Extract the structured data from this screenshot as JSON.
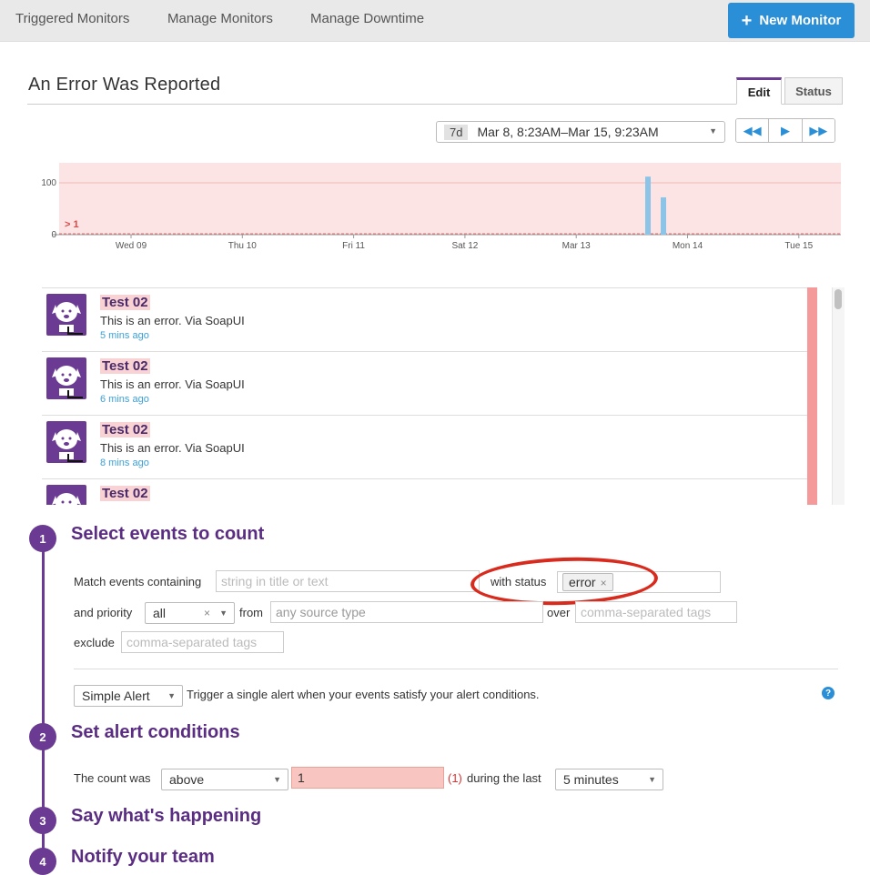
{
  "nav": {
    "tabs": [
      "Triggered Monitors",
      "Manage Monitors",
      "Manage Downtime"
    ],
    "new_monitor": "New Monitor"
  },
  "header": {
    "title": "An Error Was Reported",
    "tab_edit": "Edit",
    "tab_status": "Status"
  },
  "timeframe": {
    "span": "7d",
    "range": "Mar 8, 8:23AM–Mar 15, 9:23AM"
  },
  "chart_data": {
    "type": "bar",
    "x_ticks": [
      "Wed 09",
      "Thu 10",
      "Fri 11",
      "Sat 12",
      "Mar 13",
      "Mon 14",
      "Tue 15"
    ],
    "y_ticks": [
      0,
      100
    ],
    "ylim": [
      0,
      140
    ],
    "threshold_label": "> 1",
    "threshold": 1,
    "bars": [
      {
        "x": "Mar 13 19:30",
        "value": 112
      },
      {
        "x": "Mar 13 22:30",
        "value": 72
      }
    ],
    "colors": {
      "bar": "#8cc4e8",
      "alert_band": "#fde4e4",
      "threshold_text": "#e04848"
    }
  },
  "events": [
    {
      "title": "Test 02",
      "body": "This is an error. Via SoapUI",
      "time": "5 mins ago"
    },
    {
      "title": "Test 02",
      "body": "This is an error. Via SoapUI",
      "time": "6 mins ago"
    },
    {
      "title": "Test 02",
      "body": "This is an error. Via SoapUI",
      "time": "8 mins ago"
    },
    {
      "title": "Test 02",
      "body": "",
      "time": ""
    }
  ],
  "steps": {
    "s1": {
      "num": "1",
      "title": "Select events to count"
    },
    "s2": {
      "num": "2",
      "title": "Set alert conditions"
    },
    "s3": {
      "num": "3",
      "title": "Say what's happening"
    },
    "s4": {
      "num": "4",
      "title": "Notify your team"
    }
  },
  "form": {
    "match_label": "Match events containing",
    "match_placeholder": "string in title or text",
    "with_status_label": "with status",
    "status_tag": "error",
    "priority_label": "and priority",
    "priority_value": "all",
    "from_label": "from",
    "source_placeholder": "any source type",
    "over_label": "over",
    "tags_placeholder": "comma-separated tags",
    "exclude_label": "exclude",
    "exclude_placeholder": "comma-separated tags",
    "alert_type": "Simple Alert",
    "alert_desc": "Trigger a single alert when your events satisfy your alert conditions.",
    "count_label": "The count was",
    "count_op": "above",
    "count_value": "1",
    "count_hint": "(1)",
    "during_label": "during the last",
    "during_value": "5 minutes"
  },
  "colors": {
    "accent": "#6b3a92",
    "primary": "#2a8fd6",
    "error": "#f49a9a"
  }
}
